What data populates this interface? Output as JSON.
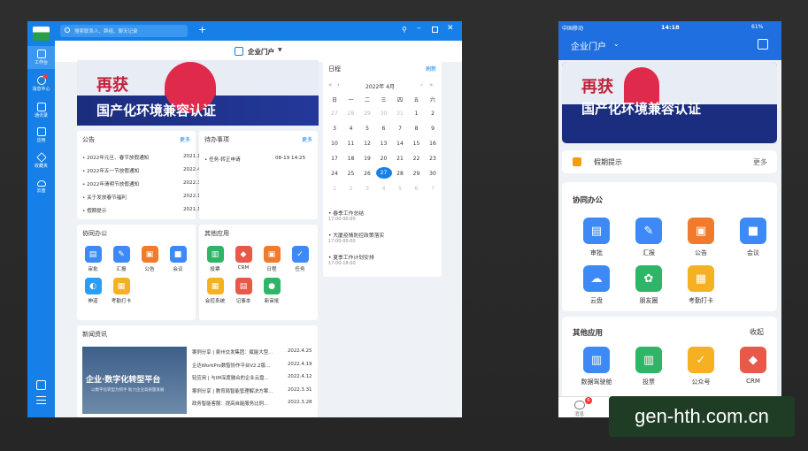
{
  "desktop": {
    "search_placeholder": "搜索联系人、群组、聊天记录",
    "portal_title": "企业门户",
    "rail": [
      "工作台",
      "消息中心",
      "通讯录",
      "应用",
      "收藏夹",
      "云盘"
    ],
    "banner": {
      "line1": "再获",
      "line2": "国产化环境兼容认证"
    },
    "notice": {
      "title": "公告",
      "more": "更多",
      "items": [
        {
          "t": "• 2022年元旦、春节放假通知",
          "d": "2021.12.28"
        },
        {
          "t": "• 2022年五一节放假通知",
          "d": "2022.4.18"
        },
        {
          "t": "• 2022年清明节放假通知",
          "d": "2022.3.26"
        },
        {
          "t": "• 关于发放春节福利",
          "d": "2022.1.26"
        },
        {
          "t": "• 假期提示",
          "d": "2021.12.31"
        }
      ]
    },
    "todo": {
      "title": "待办事项",
      "more": "更多",
      "items": [
        {
          "t": "• 任务-转正申请",
          "d": "08-19 14:25"
        }
      ]
    },
    "schedule": {
      "title": "日程",
      "more": "刷新",
      "month": "2022年 4月",
      "weekdays": [
        "日",
        "一",
        "二",
        "三",
        "四",
        "五",
        "六"
      ],
      "days": [
        "27",
        "28",
        "29",
        "30",
        "31",
        "1",
        "2",
        "3",
        "4",
        "5",
        "6",
        "7",
        "8",
        "9",
        "10",
        "11",
        "12",
        "13",
        "14",
        "15",
        "16",
        "17",
        "18",
        "19",
        "20",
        "21",
        "22",
        "23",
        "24",
        "25",
        "26",
        "27",
        "28",
        "29",
        "30",
        "1",
        "2",
        "3",
        "4",
        "5",
        "6",
        "7"
      ],
      "events": [
        {
          "t": "• 春季工作总结",
          "time": "17:00-00:00"
        },
        {
          "t": "• 大厦疫情防控政策落实",
          "time": "17:00-00:00"
        },
        {
          "t": "• 夏季工作计划安排",
          "time": "17:00-18:00"
        }
      ]
    },
    "collab": {
      "title": "协同办公",
      "apps": [
        "审批",
        "汇报",
        "公告",
        "会议",
        "伸道",
        "考勤打卡"
      ]
    },
    "other": {
      "title": "其他应用",
      "apps": [
        "投票",
        "CRM",
        "日程",
        "任务",
        "会控系统",
        "记事本",
        "新审批"
      ]
    },
    "news": {
      "title": "新闻资讯",
      "img_text": "企业·数字化转型平台",
      "img_sub": "以数字化转型为抓手 助力企业高质量发展",
      "items": [
        {
          "t": "案例分享 | 泉州交发集团：赋能大型...",
          "d": "2022.4.25"
        },
        {
          "t": "企达WorkPro数智协作平台V2.2版...",
          "d": "2022.4.19"
        },
        {
          "t": "轻应用 | 与IM深度融合的企业云盘...",
          "d": "2022.4.12"
        },
        {
          "t": "案例分享 | 教育局智能管理解决方案...",
          "d": "2022.3.31"
        },
        {
          "t": "政务智能客服：提高自能服务比例...",
          "d": "2022.3.28"
        }
      ]
    }
  },
  "phone": {
    "carrier": "中国移动",
    "time": "14:18",
    "battery": "61%",
    "portal_title": "企业门户",
    "banner": {
      "line1": "再获",
      "line2": "国产化环境兼容认证"
    },
    "notice": {
      "text": "假期提示",
      "more": "更多"
    },
    "collab": {
      "title": "协同办公",
      "apps": [
        "审批",
        "汇报",
        "公告",
        "会议",
        "云盘",
        "朋友圈",
        "考勤打卡"
      ]
    },
    "other": {
      "title": "其他应用",
      "action": "收起",
      "apps": [
        "数据驾驶舱",
        "投票",
        "公众号",
        "CRM"
      ]
    },
    "tabbar": [
      "消息",
      "",
      "",
      "",
      ""
    ],
    "badge": "6"
  },
  "watermark": "gen-hth.com.cn"
}
